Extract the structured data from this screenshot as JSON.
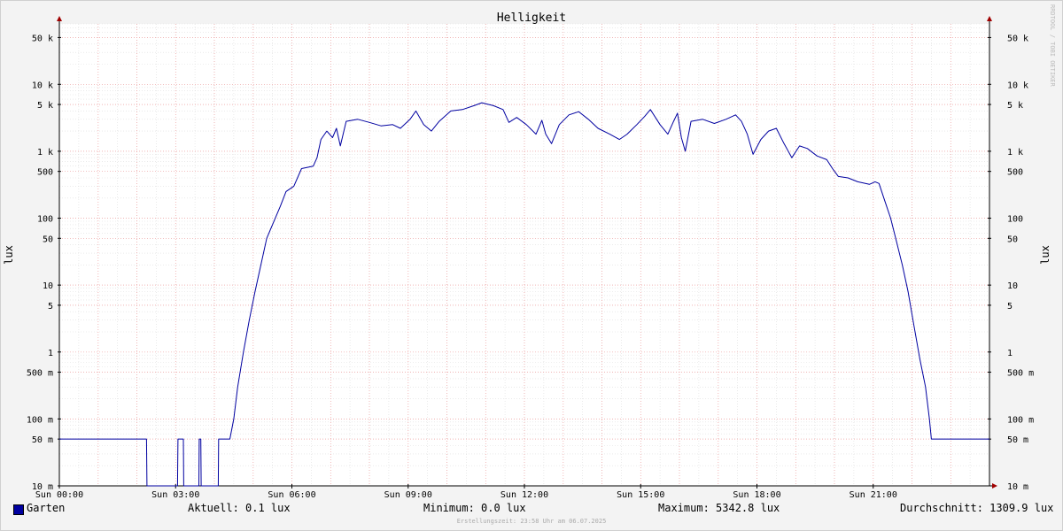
{
  "chart_data": {
    "type": "line",
    "title": "Helligkeit",
    "ylabel": "lux",
    "yscale": "log",
    "ylim": [
      0.01,
      80000
    ],
    "xlim": [
      0,
      24
    ],
    "grid": true,
    "x_ticks": [
      {
        "value": 0,
        "label": "Sun 00:00"
      },
      {
        "value": 3,
        "label": "Sun 03:00"
      },
      {
        "value": 6,
        "label": "Sun 06:00"
      },
      {
        "value": 9,
        "label": "Sun 09:00"
      },
      {
        "value": 12,
        "label": "Sun 12:00"
      },
      {
        "value": 15,
        "label": "Sun 15:00"
      },
      {
        "value": 18,
        "label": "Sun 18:00"
      },
      {
        "value": 21,
        "label": "Sun 21:00"
      }
    ],
    "y_ticks": [
      {
        "value": 0.01,
        "label": "10 m"
      },
      {
        "value": 0.05,
        "label": "50 m"
      },
      {
        "value": 0.1,
        "label": "100 m"
      },
      {
        "value": 0.5,
        "label": "500 m"
      },
      {
        "value": 1,
        "label": "1"
      },
      {
        "value": 5,
        "label": "5"
      },
      {
        "value": 10,
        "label": "10"
      },
      {
        "value": 50,
        "label": "50"
      },
      {
        "value": 100,
        "label": "100"
      },
      {
        "value": 500,
        "label": "500"
      },
      {
        "value": 1000,
        "label": "1 k"
      },
      {
        "value": 5000,
        "label": "5 k"
      },
      {
        "value": 10000,
        "label": "10 k"
      },
      {
        "value": 50000,
        "label": "50 k"
      }
    ],
    "series": [
      {
        "name": "Garten",
        "color": "#0000a0",
        "points": [
          [
            0.0,
            0.05
          ],
          [
            2.25,
            0.05
          ],
          [
            2.26,
            0.01
          ],
          [
            3.05,
            0.01
          ],
          [
            3.06,
            0.05
          ],
          [
            3.2,
            0.05
          ],
          [
            3.21,
            0.01
          ],
          [
            3.6,
            0.01
          ],
          [
            3.61,
            0.05
          ],
          [
            3.65,
            0.05
          ],
          [
            3.66,
            0.01
          ],
          [
            4.1,
            0.01
          ],
          [
            4.11,
            0.05
          ],
          [
            4.4,
            0.05
          ],
          [
            4.5,
            0.1
          ],
          [
            4.6,
            0.3
          ],
          [
            4.75,
            1
          ],
          [
            4.9,
            3
          ],
          [
            5.05,
            8
          ],
          [
            5.2,
            20
          ],
          [
            5.35,
            50
          ],
          [
            5.5,
            80
          ],
          [
            5.7,
            150
          ],
          [
            5.85,
            250
          ],
          [
            6.05,
            300
          ],
          [
            6.25,
            550
          ],
          [
            6.55,
            600
          ],
          [
            6.65,
            800
          ],
          [
            6.75,
            1500
          ],
          [
            6.9,
            2000
          ],
          [
            7.05,
            1600
          ],
          [
            7.15,
            2200
          ],
          [
            7.25,
            1200
          ],
          [
            7.4,
            2800
          ],
          [
            7.7,
            3000
          ],
          [
            8.0,
            2700
          ],
          [
            8.3,
            2400
          ],
          [
            8.6,
            2500
          ],
          [
            8.8,
            2200
          ],
          [
            9.05,
            3000
          ],
          [
            9.2,
            4000
          ],
          [
            9.4,
            2500
          ],
          [
            9.6,
            2000
          ],
          [
            9.8,
            2800
          ],
          [
            10.1,
            4000
          ],
          [
            10.4,
            4200
          ],
          [
            10.7,
            4800
          ],
          [
            10.9,
            5300
          ],
          [
            11.2,
            4800
          ],
          [
            11.45,
            4200
          ],
          [
            11.6,
            2700
          ],
          [
            11.8,
            3200
          ],
          [
            12.05,
            2500
          ],
          [
            12.3,
            1800
          ],
          [
            12.45,
            2900
          ],
          [
            12.55,
            1800
          ],
          [
            12.7,
            1300
          ],
          [
            12.9,
            2500
          ],
          [
            13.15,
            3500
          ],
          [
            13.4,
            3900
          ],
          [
            13.65,
            3000
          ],
          [
            13.9,
            2200
          ],
          [
            14.2,
            1800
          ],
          [
            14.45,
            1500
          ],
          [
            14.65,
            1800
          ],
          [
            14.9,
            2500
          ],
          [
            15.1,
            3300
          ],
          [
            15.25,
            4200
          ],
          [
            15.5,
            2500
          ],
          [
            15.7,
            1800
          ],
          [
            15.85,
            2800
          ],
          [
            15.95,
            3700
          ],
          [
            16.05,
            1600
          ],
          [
            16.15,
            1000
          ],
          [
            16.3,
            2800
          ],
          [
            16.6,
            3000
          ],
          [
            16.9,
            2600
          ],
          [
            17.2,
            3000
          ],
          [
            17.45,
            3500
          ],
          [
            17.6,
            2800
          ],
          [
            17.75,
            1800
          ],
          [
            17.9,
            900
          ],
          [
            18.1,
            1500
          ],
          [
            18.3,
            2000
          ],
          [
            18.5,
            2200
          ],
          [
            18.7,
            1300
          ],
          [
            18.9,
            800
          ],
          [
            19.1,
            1200
          ],
          [
            19.3,
            1100
          ],
          [
            19.55,
            850
          ],
          [
            19.8,
            750
          ],
          [
            19.95,
            550
          ],
          [
            20.1,
            420
          ],
          [
            20.35,
            400
          ],
          [
            20.6,
            350
          ],
          [
            20.9,
            320
          ],
          [
            21.05,
            350
          ],
          [
            21.15,
            330
          ],
          [
            21.3,
            180
          ],
          [
            21.45,
            100
          ],
          [
            21.6,
            45
          ],
          [
            21.75,
            20
          ],
          [
            21.9,
            8
          ],
          [
            22.05,
            2.5
          ],
          [
            22.2,
            0.8
          ],
          [
            22.35,
            0.3
          ],
          [
            22.45,
            0.1
          ],
          [
            22.5,
            0.05
          ],
          [
            24.0,
            0.05
          ]
        ]
      }
    ]
  },
  "legend": {
    "series_name": "Garten",
    "current": "Aktuell:    0.1 lux",
    "minimum": "Minimum:    0.0 lux",
    "maximum": "Maximum: 5342.8 lux",
    "average": "Durchschnitt: 1309.9 lux"
  },
  "footer": "Erstellungszeit: 23:58 Uhr am 06.07.2025",
  "credit": "RRDTOOL / TOBI OETIKER"
}
